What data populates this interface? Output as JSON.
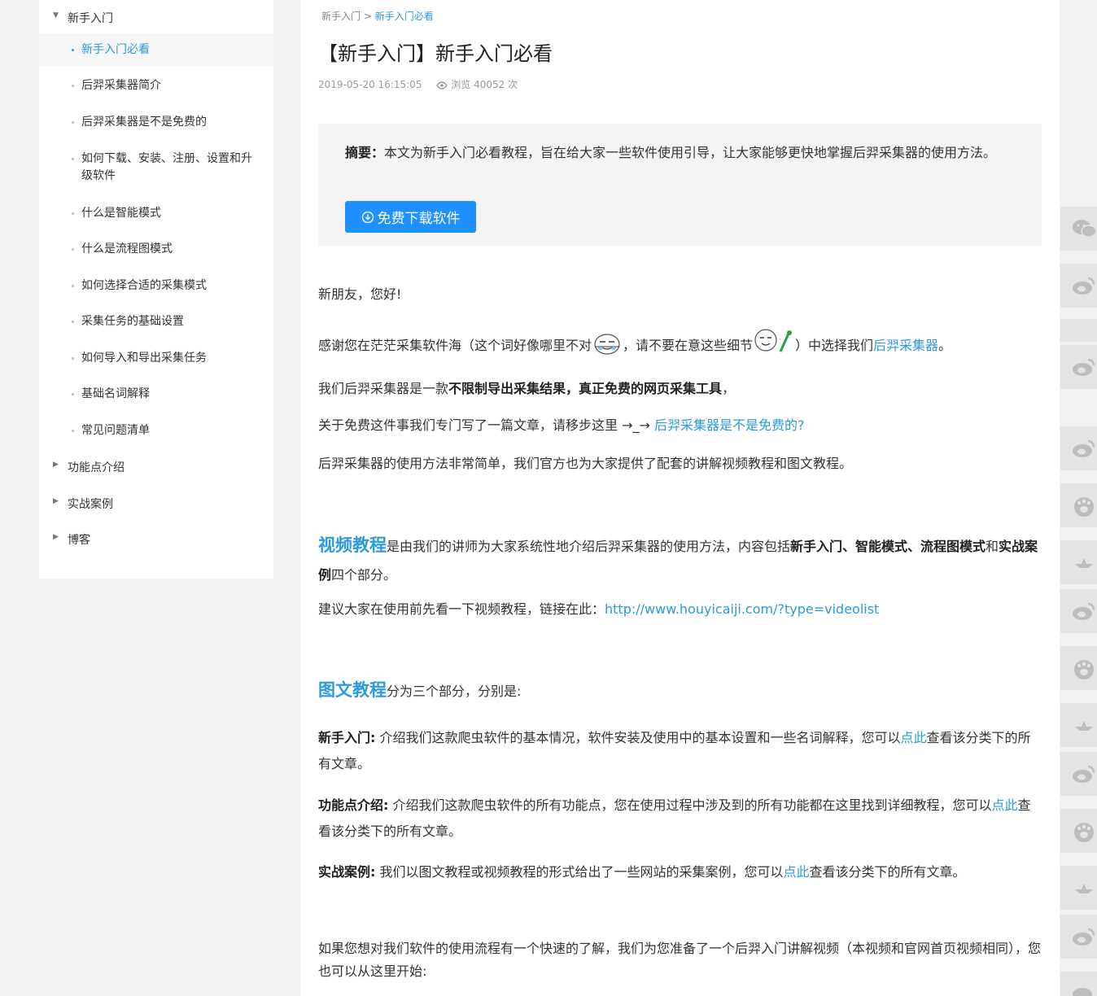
{
  "sidebar": {
    "categories": [
      {
        "label": "新手入门",
        "expanded": true
      },
      {
        "label": "功能点介绍",
        "expanded": false
      },
      {
        "label": "实战案例",
        "expanded": false
      },
      {
        "label": "博客",
        "expanded": false
      }
    ],
    "items": [
      {
        "label": "新手入门必看",
        "active": true
      },
      {
        "label": "后羿采集器简介"
      },
      {
        "label": "后羿采集器是不是免费的"
      },
      {
        "label": "如何下载、安装、注册、设置和升级软件"
      },
      {
        "label": "什么是智能模式"
      },
      {
        "label": "什么是流程图模式"
      },
      {
        "label": "如何选择合适的采集模式"
      },
      {
        "label": "采集任务的基础设置"
      },
      {
        "label": "如何导入和导出采集任务"
      },
      {
        "label": "基础名词解释"
      },
      {
        "label": "常见问题清单"
      }
    ]
  },
  "breadcrumb": {
    "root": "新手入门 >",
    "current": "新手入门必看"
  },
  "article": {
    "title": "【新手入门】新手入门必看",
    "date": "2019-05-20 16:15:05",
    "views": "浏览 40052 次",
    "summary_label": "摘要：",
    "summary_text": "本文为新手入门必看教程，旨在给大家一些软件使用引导，让大家能够更快地掌握后羿采集器的使用方法。",
    "download_label": "免费下载软件",
    "greeting": "新朋友，您好!",
    "thanks_a": "感谢您在茫茫采集软件海（这个词好像哪里不对",
    "thanks_b": "，请不要在意这些细节",
    "thanks_c": "）中选择我们",
    "thanks_link": "后羿采集器",
    "thanks_end": "。",
    "intro_a": "我们后羿采集器是一款",
    "intro_b1": "不限制导出采集结果",
    "intro_b2": "，",
    "intro_b3": "真正免费的网页采集工具",
    "intro_end": "，",
    "free_a": "关于免费这件事我们专门写了一篇文章，请移步这里 →_→ ",
    "free_link": "后羿采集器是不是免费的?",
    "usage": "后羿采集器的使用方法非常简单，我们官方也为大家提供了配套的讲解视频教程和图文教程。",
    "video_title": "视频教程",
    "video_a": "是由我们的讲师为大家系统性地介绍后羿采集器的使用方法，内容包括",
    "video_b": "新手入门、智能模式、流程图模式",
    "video_c": "和",
    "video_d": "实战案例",
    "video_e": "四个部分。",
    "video_suggest": "建议大家在使用前先看一下视频教程，链接在此：",
    "video_link": "http://www.houyicaiji.com/?type=videolist",
    "graphic_title": "图文教程",
    "graphic_a": "分为三个部分，分别是:",
    "s1_label": "新手入门:",
    "s1_a": " 介绍我们这款爬虫软件的基本情况，软件安装及使用中的基本设置和一些名词解释，您可以",
    "s1_link": "点此",
    "s1_b": "查看该分类下的所有文章。",
    "s2_label": "功能点介绍:",
    "s2_a": " 介绍我们这款爬虫软件的所有功能点，您在使用过程中涉及到的所有功能都在这里找到详细教程，您可以",
    "s2_link": "点此",
    "s2_b": "查看该分类下的所有文章。",
    "s3_label": "实战案例:",
    "s3_a": " 我们以图文教程或视频教程的形式给出了一些网站的采集案例，您可以",
    "s3_link": "点此",
    "s3_b": "查看该分类下的所有文章。",
    "final": "如果您想对我们软件的使用流程有一个快速的了解，我们为您准备了一个后羿入门讲解视频（本视频和官网首页视频相同），您也可以从这里开始:"
  },
  "share_bar": [
    "wechat-icon",
    "weibo-icon",
    "weibo-icon",
    "weibo-icon",
    "baidu-icon",
    "star-icon",
    "weibo-icon",
    "baidu-icon",
    "star-icon",
    "weibo-icon",
    "baidu-icon",
    "star-icon",
    "weibo-icon",
    "weibo-icon"
  ],
  "colors": {
    "accent": "#2d9bd9",
    "button": "#1e90ff"
  }
}
